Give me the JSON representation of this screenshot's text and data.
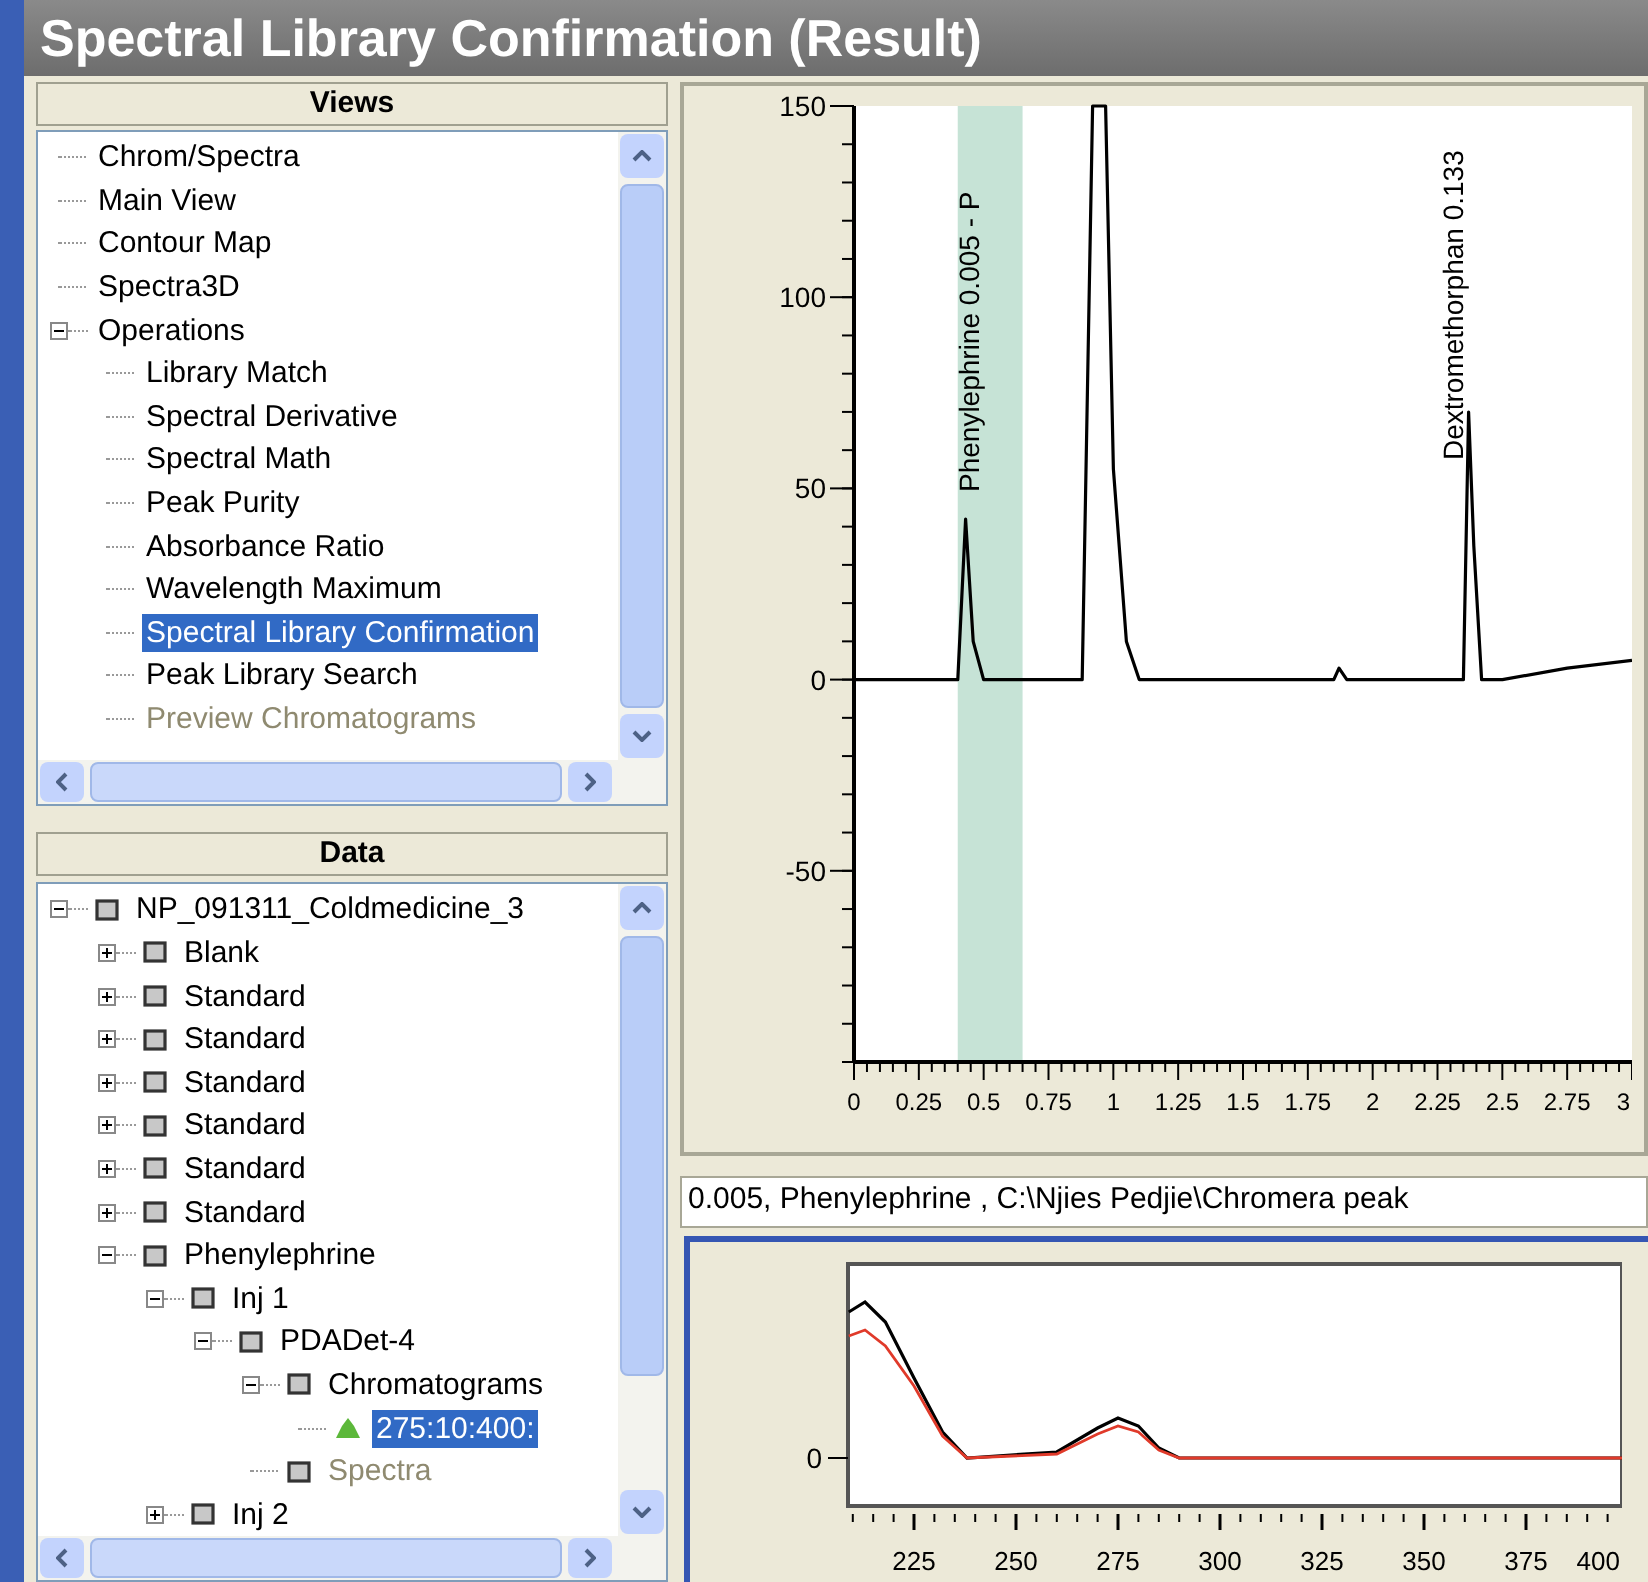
{
  "window": {
    "title": "Spectral Library Confirmation (Result)"
  },
  "views": {
    "header": "Views",
    "items": [
      {
        "label": "Chrom/Spectra",
        "selected": false
      },
      {
        "label": "Main View",
        "selected": false
      },
      {
        "label": "Contour Map",
        "selected": false
      },
      {
        "label": "Spectra3D",
        "selected": false
      },
      {
        "label": "Operations",
        "selected": false,
        "expanded": true,
        "children": [
          {
            "label": "Library Match",
            "selected": false
          },
          {
            "label": "Spectral Derivative",
            "selected": false
          },
          {
            "label": "Spectral Math",
            "selected": false
          },
          {
            "label": "Peak Purity",
            "selected": false
          },
          {
            "label": "Absorbance Ratio",
            "selected": false
          },
          {
            "label": "Wavelength Maximum",
            "selected": false
          },
          {
            "label": "Spectral Library Confirmation",
            "selected": true
          },
          {
            "label": "Peak Library Search",
            "selected": false
          },
          {
            "label": "Preview Chromatograms",
            "selected": false,
            "disabled": true
          }
        ]
      }
    ]
  },
  "data": {
    "header": "Data",
    "items": [
      {
        "label": "NP_091311_Coldmedicine_3",
        "kind": "node",
        "selected": false,
        "expanded": true,
        "children": [
          {
            "label": "Blank",
            "kind": "node",
            "selected": false,
            "expanded": false
          },
          {
            "label": "Standard",
            "kind": "node",
            "selected": false,
            "expanded": false
          },
          {
            "label": "Standard",
            "kind": "node",
            "selected": false,
            "expanded": false
          },
          {
            "label": "Standard",
            "kind": "node",
            "selected": false,
            "expanded": false
          },
          {
            "label": "Standard",
            "kind": "node",
            "selected": false,
            "expanded": false
          },
          {
            "label": "Standard",
            "kind": "node",
            "selected": false,
            "expanded": false
          },
          {
            "label": "Standard",
            "kind": "node",
            "selected": false,
            "expanded": false
          },
          {
            "label": "Phenylephrine",
            "kind": "node",
            "selected": false,
            "expanded": true,
            "children": [
              {
                "label": "Inj 1",
                "kind": "node",
                "selected": false,
                "expanded": true,
                "children": [
                  {
                    "label": "PDADet-4",
                    "kind": "node",
                    "selected": false,
                    "expanded": true,
                    "children": [
                      {
                        "label": "Chromatograms",
                        "kind": "node",
                        "selected": false,
                        "expanded": true,
                        "children": [
                          {
                            "label": "275:10:400:",
                            "kind": "chromatogram",
                            "selected": true
                          }
                        ]
                      },
                      {
                        "label": "Spectra",
                        "kind": "node",
                        "selected": false,
                        "disabled": true
                      }
                    ]
                  }
                ]
              },
              {
                "label": "Inj 2",
                "kind": "node",
                "selected": false,
                "expanded": false
              }
            ]
          }
        ]
      }
    ]
  },
  "chromatogram": {
    "chart_data": {
      "type": "line",
      "x": [
        0,
        0.3,
        0.4,
        0.43,
        0.46,
        0.5,
        0.6,
        0.88,
        0.9,
        0.92,
        0.97,
        1.0,
        1.05,
        1.1,
        1.5,
        1.85,
        1.87,
        1.9,
        2.35,
        2.37,
        2.39,
        2.42,
        2.5,
        2.75,
        3.0
      ],
      "series": [
        {
          "color": "#000000",
          "values": [
            0,
            0,
            0,
            42,
            10,
            0,
            0,
            0,
            75,
            150,
            150,
            55,
            10,
            0,
            0,
            0,
            3,
            0,
            0,
            70,
            35,
            0,
            0,
            3,
            5
          ]
        }
      ],
      "xlim": [
        0,
        3
      ],
      "ylim": [
        -100,
        150
      ],
      "xticks": [
        0,
        0.25,
        0.5,
        0.75,
        1,
        1.25,
        1.5,
        1.75,
        2,
        2.25,
        2.5,
        2.75,
        3
      ],
      "yticks": [
        -50,
        0,
        50,
        100,
        150
      ],
      "bands": [
        {
          "axis": "x",
          "from": 0.4,
          "to": 0.65,
          "color": "#c6e3d6"
        }
      ],
      "annotations": [
        "Phenylephrine 0.005 - P",
        "Dextromethorphan 0.133"
      ]
    }
  },
  "info_text": "0.005, Phenylephrine , C:\\Njies Pedjie\\Chromera peak",
  "spectrum": {
    "y_tick_label": "0",
    "x_tick_labels": [
      "225",
      "250",
      "275",
      "300",
      "325",
      "350",
      "375",
      "400"
    ]
  }
}
